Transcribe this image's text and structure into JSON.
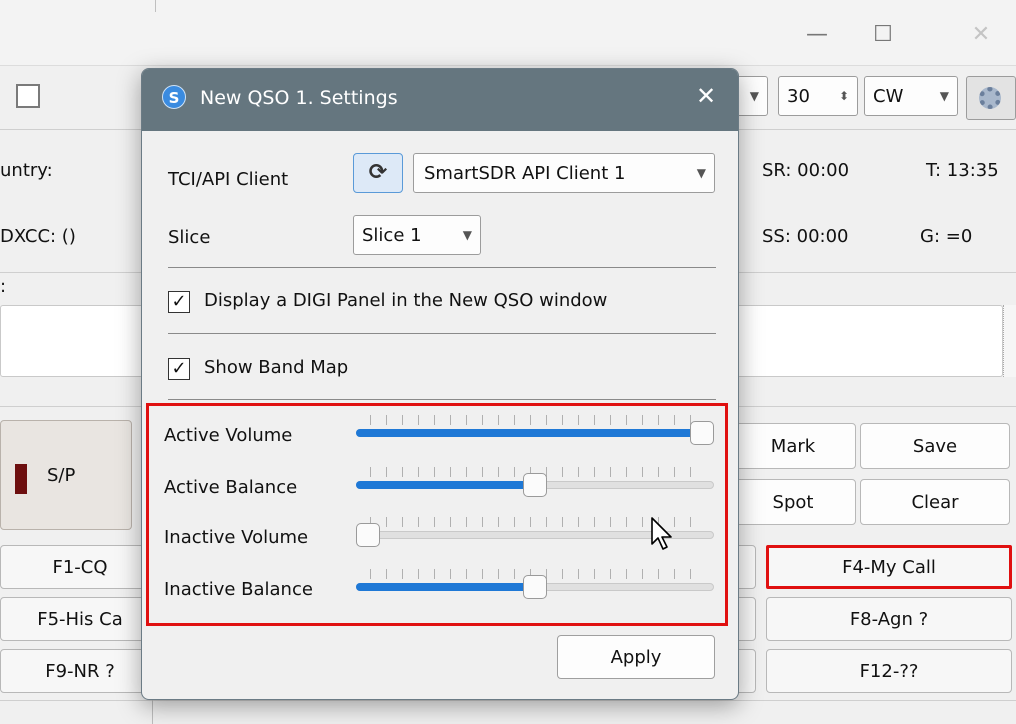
{
  "window": {
    "minimize_glyph": "—",
    "maximize_glyph": "☐",
    "close_glyph": "✕"
  },
  "toolbar": {
    "step_value": "30",
    "mode_value": "CW"
  },
  "background_info": {
    "country_label": "untry:",
    "dxcc_label": "DXCC: ()",
    "sr_label": "SR: 00:00",
    "t_label": "T: 13:35",
    "ss_label": "SS: 00:00",
    "g_label": "G: =0",
    "colon": ":"
  },
  "sp_button": {
    "label": "S/P"
  },
  "buttons": {
    "mark": "Mark",
    "save": "Save",
    "spot": "Spot",
    "clear": "Clear"
  },
  "function_keys": {
    "f1": "F1-CQ",
    "f4": "F4-My Call",
    "f5": "F5-His Ca",
    "f8": "F8-Agn ?",
    "f9": "F9-NR ?",
    "f12": "F12-??"
  },
  "dialog": {
    "icon_letter": "S",
    "title": "New QSO 1. Settings",
    "close_glyph": "✕",
    "tci_label": "TCI/API Client",
    "refresh_glyph": "⟳",
    "tci_value": "SmartSDR API Client 1",
    "slice_label": "Slice",
    "slice_value": "Slice 1",
    "digi_panel_label": "Display a DIGI Panel in the New QSO window",
    "digi_panel_checked": true,
    "band_map_label": "Show Band Map",
    "band_map_checked": true,
    "check_glyph": "✓",
    "apply_label": "Apply",
    "sliders": [
      {
        "label": "Active Volume",
        "value": 1.0
      },
      {
        "label": "Active Balance",
        "value": 0.5
      },
      {
        "label": "Inactive Volume",
        "value": 0.0
      },
      {
        "label": "Inactive Balance",
        "value": 0.5
      }
    ]
  },
  "colors": {
    "title_bar": "#65767f",
    "accent": "#1e78d6",
    "highlight_red": "#e01010"
  }
}
